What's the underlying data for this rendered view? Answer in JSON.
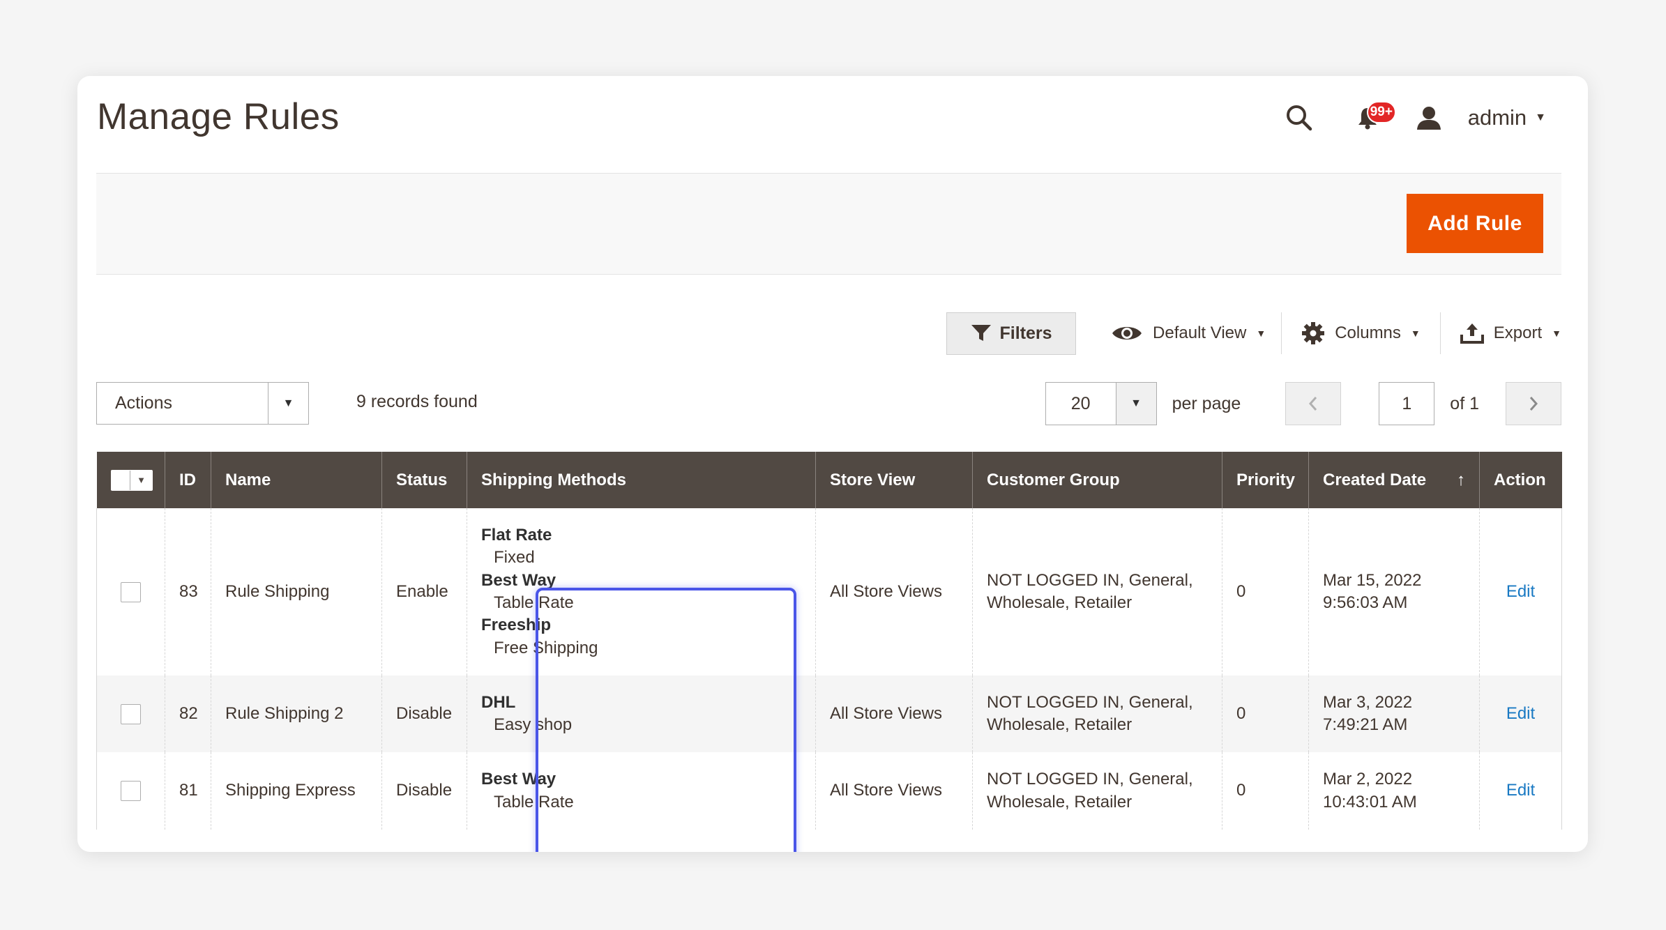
{
  "page": {
    "title": "Manage Rules"
  },
  "header": {
    "search_icon": "search-icon",
    "notifications_count": "99+",
    "user_icon": "user-icon",
    "admin_label": "admin"
  },
  "page_actions": {
    "add_rule_label": "Add Rule"
  },
  "toolbar": {
    "filters_label": "Filters",
    "view_label": "Default View",
    "columns_label": "Columns",
    "export_label": "Export"
  },
  "grid_controls": {
    "actions_label": "Actions",
    "records_found": "9 records found",
    "per_page_value": "20",
    "per_page_label": "per page",
    "current_page": "1",
    "of_pages": "of 1"
  },
  "grid": {
    "columns": [
      "ID",
      "Name",
      "Status",
      "Shipping Methods",
      "Store View",
      "Customer Group",
      "Priority",
      "Created Date",
      "Action"
    ],
    "sort_indicator": "↑",
    "rows": [
      {
        "id": "83",
        "name": "Rule Shipping",
        "status": "Enable",
        "methods": [
          {
            "title": "Flat Rate",
            "sub": "Fixed"
          },
          {
            "title": "Best Way",
            "sub": "Table Rate"
          },
          {
            "title": "Freeship",
            "sub": "Free Shipping"
          }
        ],
        "store_view": "All Store Views",
        "group_line1": "NOT LOGGED IN, General,",
        "group_line2": "Wholesale, Retailer",
        "priority": "0",
        "date_line1": "Mar 15, 2022",
        "date_line2": "9:56:03 AM",
        "action": "Edit"
      },
      {
        "id": "82",
        "name": "Rule Shipping 2",
        "status": "Disable",
        "methods": [
          {
            "title": "DHL",
            "sub": "Easy shop"
          }
        ],
        "store_view": "All Store Views",
        "group_line1": "NOT LOGGED IN, General,",
        "group_line2": "Wholesale, Retailer",
        "priority": "0",
        "date_line1": "Mar 3, 2022",
        "date_line2": "7:49:21 AM",
        "action": "Edit"
      },
      {
        "id": "81",
        "name": "Shipping Express",
        "status": "Disable",
        "methods": [
          {
            "title": "Best Way",
            "sub": "Table Rate"
          }
        ],
        "store_view": "All Store Views",
        "group_line1": "NOT LOGGED IN, General,",
        "group_line2": "Wholesale, Retailer",
        "priority": "0",
        "date_line1": "Mar 2, 2022",
        "date_line2": "10:43:01 AM",
        "action": "Edit"
      }
    ]
  },
  "colors": {
    "accent": "#eb5202",
    "header_bg": "#514943",
    "link": "#1979c3",
    "highlight": "#4a55e8",
    "badge": "#e22626"
  }
}
